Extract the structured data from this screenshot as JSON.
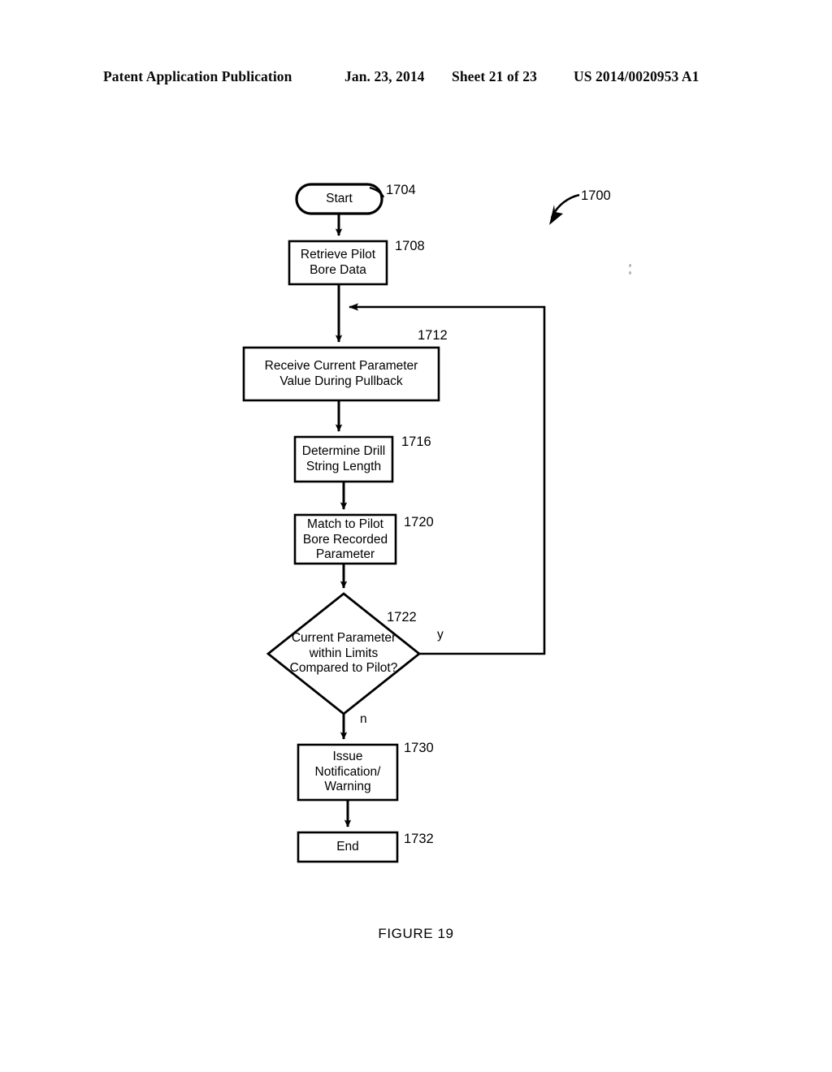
{
  "header": {
    "publication": "Patent Application Publication",
    "date": "Jan. 23, 2014",
    "sheet": "Sheet 21 of 23",
    "patent_number": "US 2014/0020953 A1"
  },
  "figure": {
    "caption": "FIGURE 19",
    "diagram_ref": "1700"
  },
  "flowchart": {
    "type": "flowchart",
    "nodes": [
      {
        "id": "start",
        "ref": "1704",
        "shape": "terminator-rounded",
        "lines": [
          "Start"
        ]
      },
      {
        "id": "retrieve",
        "ref": "1708",
        "shape": "process",
        "lines": [
          "Retrieve Pilot",
          "Bore Data"
        ]
      },
      {
        "id": "receive",
        "ref": "1712",
        "shape": "process",
        "lines": [
          "Receive Current Parameter",
          "Value During Pullback"
        ]
      },
      {
        "id": "determine",
        "ref": "1716",
        "shape": "process",
        "lines": [
          "Determine Drill",
          "String Length"
        ]
      },
      {
        "id": "match",
        "ref": "1720",
        "shape": "process",
        "lines": [
          "Match to Pilot",
          "Bore Recorded",
          "Parameter"
        ]
      },
      {
        "id": "decision",
        "ref": "1722",
        "shape": "decision",
        "lines": [
          "Current Parameter",
          "within Limits",
          "Compared to Pilot?"
        ]
      },
      {
        "id": "notify",
        "ref": "1730",
        "shape": "process",
        "lines": [
          "Issue",
          "Notification/",
          "Warning"
        ]
      },
      {
        "id": "end",
        "ref": "1732",
        "shape": "terminator",
        "lines": [
          "End"
        ]
      }
    ],
    "branch_labels": {
      "yes": "y",
      "no": "n"
    },
    "edges": [
      {
        "from": "start",
        "to": "retrieve",
        "label": ""
      },
      {
        "from": "retrieve",
        "to": "receive",
        "label": ""
      },
      {
        "from": "receive",
        "to": "determine",
        "label": ""
      },
      {
        "from": "determine",
        "to": "match",
        "label": ""
      },
      {
        "from": "match",
        "to": "decision",
        "label": ""
      },
      {
        "from": "decision",
        "to": "receive",
        "label": "y"
      },
      {
        "from": "decision",
        "to": "notify",
        "label": "n"
      },
      {
        "from": "notify",
        "to": "end",
        "label": ""
      }
    ]
  }
}
